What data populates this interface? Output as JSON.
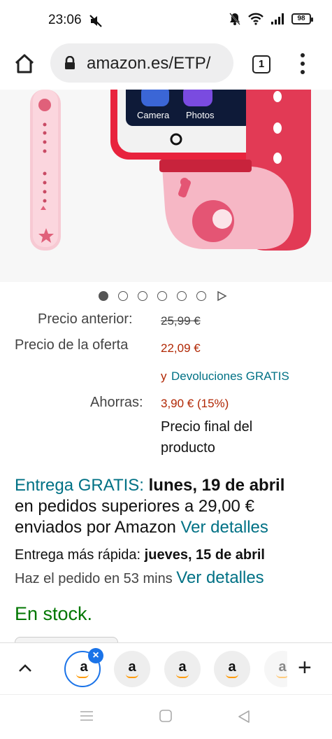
{
  "status_bar": {
    "time": "23:06",
    "battery": "98",
    "icons": [
      "mute-icon",
      "alarm-off-icon",
      "wifi-icon",
      "signal-icon",
      "battery-icon"
    ]
  },
  "browser": {
    "url": "amazon.es/ETP/",
    "tab_count": "1"
  },
  "product_image": {
    "screen_labels": [
      "Camera",
      "Photos"
    ]
  },
  "carousel": {
    "dot_count": 6,
    "active_index": 0
  },
  "pricing": {
    "previous_label": "Precio anterior:",
    "previous_value": "25,99 €",
    "offer_label": "Precio de la oferta",
    "offer_value": "22,09 €",
    "returns_prefix": "y",
    "returns_link": "Devoluciones GRATIS",
    "savings_label": "Ahorras:",
    "savings_value": "3,90 € (15%)",
    "final_line1": "Precio final del",
    "final_line2": "producto"
  },
  "delivery": {
    "free_label": "Entrega GRATIS:",
    "free_date": "lunes, 19 de abril",
    "line2": "en pedidos superiores a 29,00 €",
    "line3_text": "enviados por Amazon",
    "details_link": "Ver detalles",
    "fast_label": "Entrega más rápida:",
    "fast_date": "jueves, 15 de abril",
    "order_within": "Haz el pedido en 53 mins",
    "fast_details_link": "Ver detalles"
  },
  "stock": "En stock.",
  "tab_strip": {
    "tab_letter": "a",
    "add_label": "+"
  },
  "colors": {
    "price_red": "#b12704",
    "link_teal": "#007185",
    "stock_green": "#007600",
    "active_tab_blue": "#1a73e8"
  }
}
